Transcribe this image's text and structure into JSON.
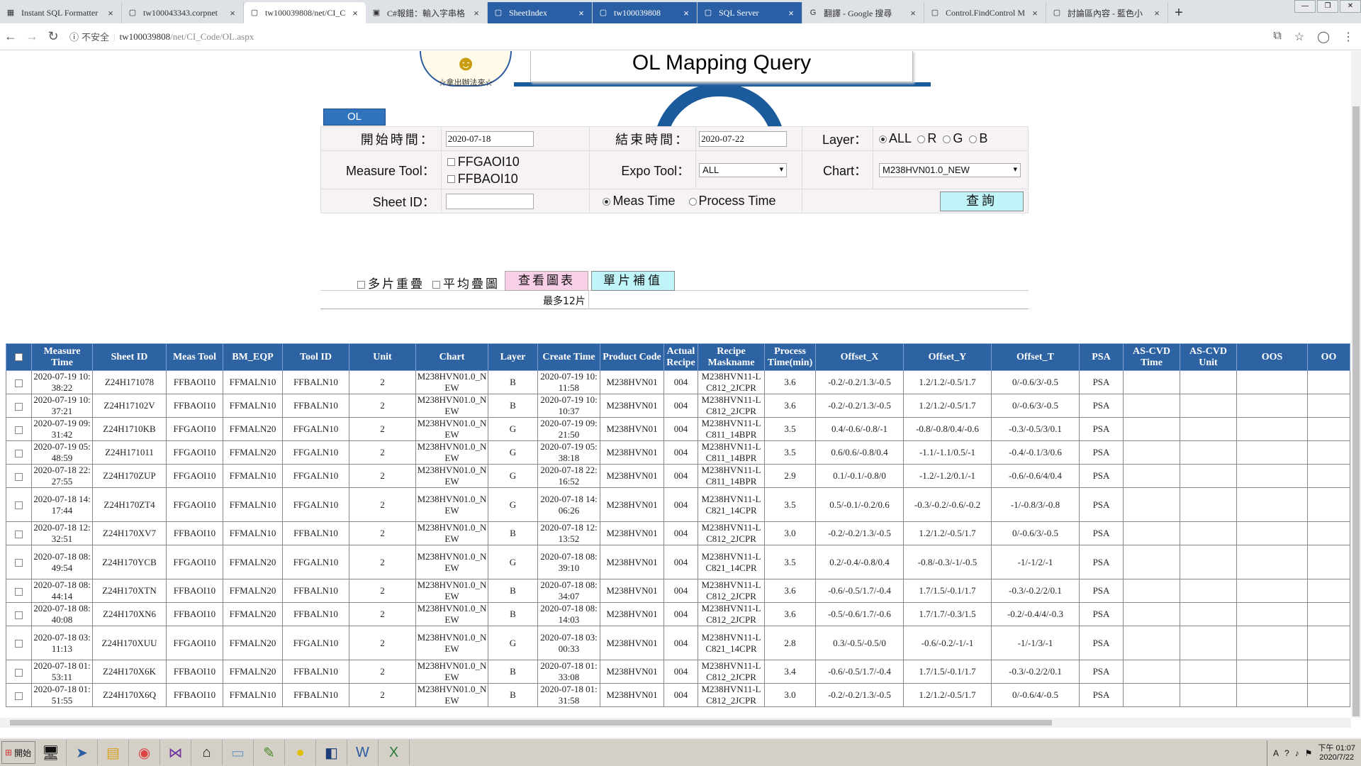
{
  "browser": {
    "tabs": [
      {
        "icon": "sql-formatter-icon",
        "title": "Instant SQL Formatter",
        "active": false
      },
      {
        "icon": "page-icon",
        "title": "tw100043343.corpnet",
        "active": false
      },
      {
        "icon": "page-icon",
        "title": "tw100039808/net/CI_C",
        "active": true
      },
      {
        "icon": "csharp-icon",
        "title": "C#報錯：輸入字串格",
        "active": false
      },
      {
        "icon": "window-icon",
        "title": "SheetIndex",
        "active": false,
        "dark": true
      },
      {
        "icon": "window-icon",
        "title": "tw100039808",
        "active": false,
        "dark": true
      },
      {
        "icon": "sql-icon",
        "title": "SQL Server",
        "active": false,
        "dark": true
      },
      {
        "icon": "google-icon",
        "title": "翻譯 - Google 搜尋",
        "active": false
      },
      {
        "icon": "office-icon",
        "title": "Control.FindControl M",
        "active": false
      },
      {
        "icon": "page-icon",
        "title": "討論區內容 - 藍色小",
        "active": false
      }
    ],
    "security_label": "不安全",
    "url_host": "tw100039808",
    "url_path": "/net/CI_Code/OL.aspx"
  },
  "header": {
    "logo_motto": "☆拿出辦法來☆",
    "page_title": "OL Mapping Query",
    "tab_label": "OL"
  },
  "form": {
    "start_time_label": "開始時間：",
    "start_time_value": "2020-07-18",
    "end_time_label": "結束時間：",
    "end_time_value": "2020-07-22",
    "layer_label": "Layer：",
    "layer_options": [
      "ALL",
      "R",
      "G",
      "B"
    ],
    "layer_selected": "ALL",
    "measure_tool_label": "Measure Tool：",
    "measure_tools": [
      "FFGAOI10",
      "FFBAOI10"
    ],
    "expo_tool_label": "Expo Tool：",
    "expo_tool_value": "ALL",
    "chart_label": "Chart：",
    "chart_value": "M238HVN01.0_NEW",
    "sheet_id_label": "Sheet ID：",
    "sheet_id_value": "",
    "time_options": [
      "Meas Time",
      "Process Time"
    ],
    "time_selected": "Meas Time",
    "query_button": "查詢",
    "multi_overlay_label": "多片重疊",
    "avg_overlay_label": "平均疊圖",
    "view_chart_button": "查看圖表",
    "single_comp_button": "單片補值",
    "max_note": "最多12片"
  },
  "table": {
    "headers": [
      "Measure Time",
      "Sheet ID",
      "Meas Tool",
      "BM_EQP",
      "Tool ID",
      "Unit",
      "Chart",
      "Layer",
      "Create Time",
      "Product Code",
      "Actual Recipe",
      "Recipe Maskname",
      "Process Time(min)",
      "Offset_X",
      "Offset_Y",
      "Offset_T",
      "PSA",
      "AS-CVD Time",
      "AS-CVD Unit",
      "OOS",
      "OO"
    ],
    "rows": [
      [
        "2020-07-19 10:38:22",
        "Z24H171078",
        "FFBAOI10",
        "FFMALN10",
        "FFBALN10",
        "2",
        "M238HVN01.0_NEW",
        "B",
        "2020-07-19 10:11:58",
        "M238HVN01",
        "004",
        "M238HVN11-LC812_2JCPR",
        "3.6",
        "-0.2/-0.2/1.3/-0.5",
        "1.2/1.2/-0.5/1.7",
        "0/-0.6/3/-0.5",
        "PSA",
        "",
        "",
        "",
        ""
      ],
      [
        "2020-07-19 10:37:21",
        "Z24H17102V",
        "FFBAOI10",
        "FFMALN10",
        "FFBALN10",
        "2",
        "M238HVN01.0_NEW",
        "B",
        "2020-07-19 10:10:37",
        "M238HVN01",
        "004",
        "M238HVN11-LC812_2JCPR",
        "3.6",
        "-0.2/-0.2/1.3/-0.5",
        "1.2/1.2/-0.5/1.7",
        "0/-0.6/3/-0.5",
        "PSA",
        "",
        "",
        "",
        ""
      ],
      [
        "2020-07-19 09:31:42",
        "Z24H1710KB",
        "FFGAOI10",
        "FFMALN20",
        "FFGALN10",
        "2",
        "M238HVN01.0_NEW",
        "G",
        "2020-07-19 09:21:50",
        "M238HVN01",
        "004",
        "M238HVN11-LC811_14BPR",
        "3.5",
        "0.4/-0.6/-0.8/-1",
        "-0.8/-0.8/0.4/-0.6",
        "-0.3/-0.5/3/0.1",
        "PSA",
        "",
        "",
        "",
        ""
      ],
      [
        "2020-07-19 05:48:59",
        "Z24H171011",
        "FFGAOI10",
        "FFMALN20",
        "FFGALN10",
        "2",
        "M238HVN01.0_NEW",
        "G",
        "2020-07-19 05:38:18",
        "M238HVN01",
        "004",
        "M238HVN11-LC811_14BPR",
        "3.5",
        "0.6/0.6/-0.8/0.4",
        "-1.1/-1.1/0.5/-1",
        "-0.4/-0.1/3/0.6",
        "PSA",
        "",
        "",
        "",
        ""
      ],
      [
        "2020-07-18 22:27:55",
        "Z24H170ZUP",
        "FFGAOI10",
        "FFMALN10",
        "FFGALN10",
        "2",
        "M238HVN01.0_NEW",
        "G",
        "2020-07-18 22:16:52",
        "M238HVN01",
        "004",
        "M238HVN11-LC811_14BPR",
        "2.9",
        "0.1/-0.1/-0.8/0",
        "-1.2/-1.2/0.1/-1",
        "-0.6/-0.6/4/0.4",
        "PSA",
        "",
        "",
        "",
        ""
      ],
      [
        "2020-07-18 14:17:44",
        "Z24H170ZT4",
        "FFGAOI10",
        "FFMALN10",
        "FFGALN10",
        "2",
        "M238HVN01.0_NEW",
        "G",
        "2020-07-18 14:06:26",
        "M238HVN01",
        "004",
        "M238HVN11-LC821_14CPR",
        "3.5",
        "0.5/-0.1/-0.2/0.6",
        "-0.3/-0.2/-0.6/-0.2",
        "-1/-0.8/3/-0.8",
        "PSA",
        "",
        "",
        "",
        ""
      ],
      [
        "2020-07-18 12:32:51",
        "Z24H170XV7",
        "FFBAOI10",
        "FFMALN10",
        "FFBALN10",
        "2",
        "M238HVN01.0_NEW",
        "B",
        "2020-07-18 12:13:52",
        "M238HVN01",
        "004",
        "M238HVN11-LC812_2JCPR",
        "3.0",
        "-0.2/-0.2/1.3/-0.5",
        "1.2/1.2/-0.5/1.7",
        "0/-0.6/3/-0.5",
        "PSA",
        "",
        "",
        "",
        ""
      ],
      [
        "2020-07-18 08:49:54",
        "Z24H170YCB",
        "FFGAOI10",
        "FFMALN20",
        "FFGALN10",
        "2",
        "M238HVN01.0_NEW",
        "G",
        "2020-07-18 08:39:10",
        "M238HVN01",
        "004",
        "M238HVN11-LC821_14CPR",
        "3.5",
        "0.2/-0.4/-0.8/0.4",
        "-0.8/-0.3/-1/-0.5",
        "-1/-1/2/-1",
        "PSA",
        "",
        "",
        "",
        ""
      ],
      [
        "2020-07-18 08:44:14",
        "Z24H170XTN",
        "FFBAOI10",
        "FFMALN20",
        "FFBALN10",
        "2",
        "M238HVN01.0_NEW",
        "B",
        "2020-07-18 08:34:07",
        "M238HVN01",
        "004",
        "M238HVN11-LC812_2JCPR",
        "3.6",
        "-0.6/-0.5/1.7/-0.4",
        "1.7/1.5/-0.1/1.7",
        "-0.3/-0.2/2/0.1",
        "PSA",
        "",
        "",
        "",
        ""
      ],
      [
        "2020-07-18 08:40:08",
        "Z24H170XN6",
        "FFBAOI10",
        "FFMALN20",
        "FFBALN10",
        "2",
        "M238HVN01.0_NEW",
        "B",
        "2020-07-18 08:14:03",
        "M238HVN01",
        "004",
        "M238HVN11-LC812_2JCPR",
        "3.6",
        "-0.5/-0.6/1.7/-0.6",
        "1.7/1.7/-0.3/1.5",
        "-0.2/-0.4/4/-0.3",
        "PSA",
        "",
        "",
        "",
        ""
      ],
      [
        "2020-07-18 03:11:13",
        "Z24H170XUU",
        "FFGAOI10",
        "FFMALN20",
        "FFGALN10",
        "2",
        "M238HVN01.0_NEW",
        "G",
        "2020-07-18 03:00:33",
        "M238HVN01",
        "004",
        "M238HVN11-LC821_14CPR",
        "2.8",
        "0.3/-0.5/-0.5/0",
        "-0.6/-0.2/-1/-1",
        "-1/-1/3/-1",
        "PSA",
        "",
        "",
        "",
        ""
      ],
      [
        "2020-07-18 01:53:11",
        "Z24H170X6K",
        "FFBAOI10",
        "FFMALN20",
        "FFBALN10",
        "2",
        "M238HVN01.0_NEW",
        "B",
        "2020-07-18 01:33:08",
        "M238HVN01",
        "004",
        "M238HVN11-LC812_2JCPR",
        "3.4",
        "-0.6/-0.5/1.7/-0.4",
        "1.7/1.5/-0.1/1.7",
        "-0.3/-0.2/2/0.1",
        "PSA",
        "",
        "",
        "",
        ""
      ],
      [
        "2020-07-18 01:51:55",
        "Z24H170X6Q",
        "FFBAOI10",
        "FFMALN10",
        "FFBALN10",
        "2",
        "M238HVN01.0_NEW",
        "B",
        "2020-07-18 01:31:58",
        "M238HVN01",
        "004",
        "M238HVN11-LC812_2JCPR",
        "3.0",
        "-0.2/-0.2/1.3/-0.5",
        "1.2/1.2/-0.5/1.7",
        "0/-0.6/4/-0.5",
        "PSA",
        "",
        "",
        "",
        ""
      ]
    ]
  },
  "taskbar": {
    "start_label": "開始",
    "clock_time": "下午 01:07",
    "clock_date": "2020/7/22"
  }
}
